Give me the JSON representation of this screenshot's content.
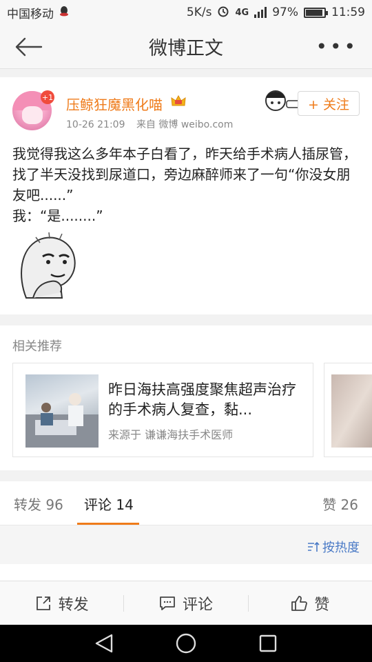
{
  "status_bar": {
    "carrier": "中国移动",
    "speed": "5K/s",
    "network": "4G",
    "battery": "97%",
    "time": "11:59"
  },
  "header": {
    "title": "微博正文"
  },
  "post": {
    "badge": "+1",
    "username": "压鲸狂魔黑化喵",
    "date": "10-26 21:09",
    "source": "来自 微博 weibo.com",
    "follow_label": "+ 关注",
    "text_line1": "我觉得我这么多年本子白看了，昨天给手术病人插尿管，找了半天没找到尿道口，旁边麻醉师来了一句“你没女朋友吧......”",
    "text_line2": "我：“是........”"
  },
  "related": {
    "label": "相关推荐",
    "card": {
      "title": "昨日海扶高强度聚焦超声治疗的手术病人复查，黏...",
      "source": "来源于 谦谦海扶手术医师"
    }
  },
  "tabs": {
    "repost": "转发 96",
    "comment": "评论 14",
    "like": "赞 26"
  },
  "sort_label": "按热度",
  "toolbar": {
    "repost": "转发",
    "comment": "评论",
    "like": "赞"
  },
  "colors": {
    "accent": "#ef7b1a",
    "link": "#4a7ac6"
  }
}
